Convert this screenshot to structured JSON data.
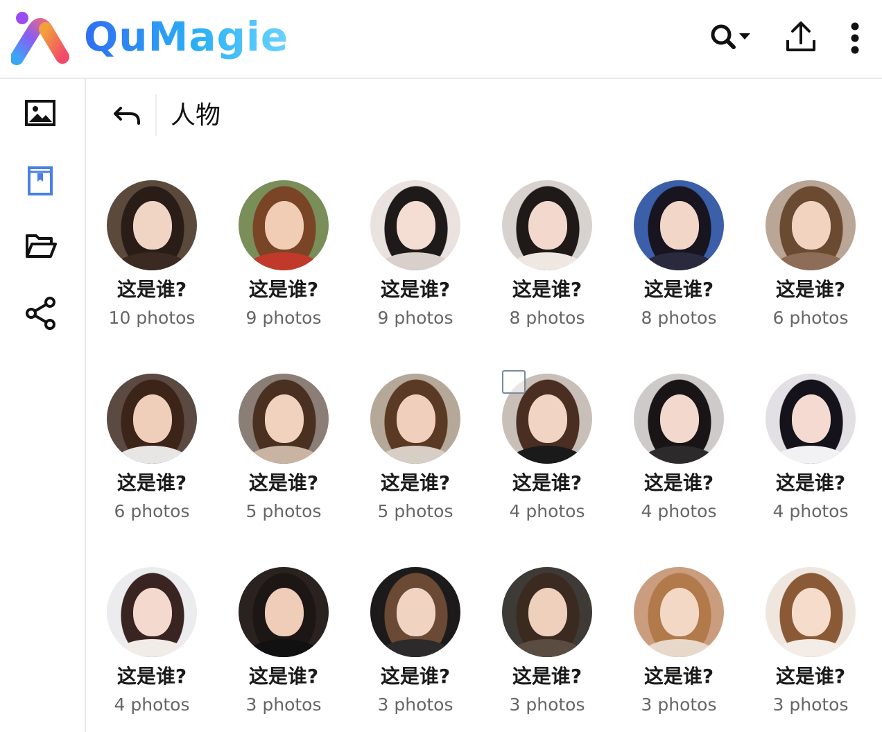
{
  "app": {
    "name": "QuMagie",
    "accent": "#2f6ef2"
  },
  "header": {
    "icons": [
      "search-icon",
      "dropdown-caret-icon",
      "upload-icon",
      "more-vertical-icon"
    ]
  },
  "sidebar": {
    "items": [
      {
        "icon": "photos-icon",
        "active": false
      },
      {
        "icon": "album-icon",
        "active": true
      },
      {
        "icon": "folder-icon",
        "active": false
      },
      {
        "icon": "share-icon",
        "active": false
      }
    ],
    "active_color": "#4a7ee8"
  },
  "breadcrumb": {
    "title": "人物"
  },
  "people": [
    {
      "name": "这是谁?",
      "count": "10 photos",
      "hair": "#2a1d17",
      "skin": "#f1d5c4",
      "bg": "#5b4a3c",
      "cloth": "#3a2a22"
    },
    {
      "name": "这是谁?",
      "count": "9 photos",
      "hair": "#7a4426",
      "skin": "#f0cdb4",
      "bg": "#7a8e5a",
      "cloth": "#c0392b"
    },
    {
      "name": "这是谁?",
      "count": "9 photos",
      "hair": "#1e1a19",
      "skin": "#f4ddd2",
      "bg": "#e9e2df",
      "cloth": "#d9d0cc"
    },
    {
      "name": "这是谁?",
      "count": "8 photos",
      "hair": "#1f1a18",
      "skin": "#f3d9cd",
      "bg": "#d8d2cf",
      "cloth": "#efe7e2"
    },
    {
      "name": "这是谁?",
      "count": "8 photos",
      "hair": "#181420",
      "skin": "#f2d6c8",
      "bg": "#3b5fa8",
      "cloth": "#2a2a3e"
    },
    {
      "name": "这是谁?",
      "count": "6 photos",
      "hair": "#6a4a30",
      "skin": "#f2d3c0",
      "bg": "#b9a696",
      "cloth": "#8e6d58"
    },
    {
      "name": "这是谁?",
      "count": "6 photos",
      "hair": "#3c2418",
      "skin": "#efcfba",
      "bg": "#5a4a42",
      "cloth": "#e8e6e4"
    },
    {
      "name": "这是谁?",
      "count": "5 photos",
      "hair": "#4a3020",
      "skin": "#f1d2be",
      "bg": "#8a7e76",
      "cloth": "#c9b3a3"
    },
    {
      "name": "这是谁?",
      "count": "5 photos",
      "hair": "#5a3a24",
      "skin": "#f0d0bc",
      "bg": "#b6a898",
      "cloth": "#d7cfc6"
    },
    {
      "name": "这是谁?",
      "count": "4 photos",
      "hair": "#4a2e22",
      "skin": "#f1d4c3",
      "bg": "#c8bfb8",
      "cloth": "#1a1a1a"
    },
    {
      "name": "这是谁?",
      "count": "4 photos",
      "hair": "#191516",
      "skin": "#f3d8ce",
      "bg": "#cfcaca",
      "cloth": "#2d2a2b"
    },
    {
      "name": "这是谁?",
      "count": "4 photos",
      "hair": "#14121a",
      "skin": "#f4dad0",
      "bg": "#e2e0e4",
      "cloth": "#f2f2f4"
    },
    {
      "name": "这是谁?",
      "count": "4 photos",
      "hair": "#3a2422",
      "skin": "#f4d9cf",
      "bg": "#ecebed",
      "cloth": "#f1ece8"
    },
    {
      "name": "这是谁?",
      "count": "3 photos",
      "hair": "#1c1614",
      "skin": "#efcdb8",
      "bg": "#2a221e",
      "cloth": "#111111"
    },
    {
      "name": "这是谁?",
      "count": "3 photos",
      "hair": "#6a4a34",
      "skin": "#f1d3c1",
      "bg": "#1c1a1a",
      "cloth": "#2c2a2a"
    },
    {
      "name": "这是谁?",
      "count": "3 photos",
      "hair": "#3b2a20",
      "skin": "#efd0bd",
      "bg": "#3e3a36",
      "cloth": "#5a4c40"
    },
    {
      "name": "这是谁?",
      "count": "3 photos",
      "hair": "#b27a4a",
      "skin": "#f4d8c6",
      "bg": "#c99d7e",
      "cloth": "#e8d8ca"
    },
    {
      "name": "这是谁?",
      "count": "3 photos",
      "hair": "#8a5a36",
      "skin": "#f6dccb",
      "bg": "#efe6df",
      "cloth": "#f4ece6"
    }
  ]
}
